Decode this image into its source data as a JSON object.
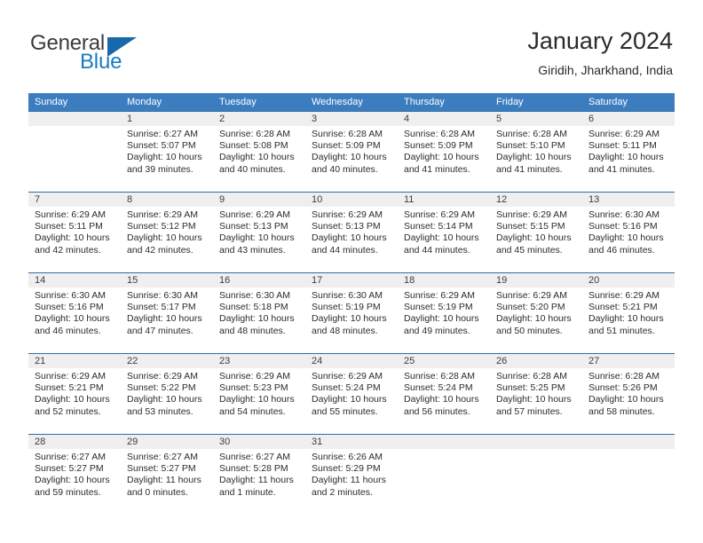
{
  "brand": {
    "name_top": "General",
    "name_bottom": "Blue",
    "accent_color": "#1b7cc2",
    "triangle_color": "#1769ab"
  },
  "header": {
    "title": "January 2024",
    "location": "Giridih, Jharkhand, India"
  },
  "theme": {
    "header_band": "#3b7dbf",
    "row_band": "#efefef",
    "row_divider": "#2e6da4"
  },
  "weekdays": [
    "Sunday",
    "Monday",
    "Tuesday",
    "Wednesday",
    "Thursday",
    "Friday",
    "Saturday"
  ],
  "weeks": [
    [
      {
        "day": "",
        "sunrise": "",
        "sunset": "",
        "daylight_a": "",
        "daylight_b": ""
      },
      {
        "day": "1",
        "sunrise": "Sunrise: 6:27 AM",
        "sunset": "Sunset: 5:07 PM",
        "daylight_a": "Daylight: 10 hours",
        "daylight_b": "and 39 minutes."
      },
      {
        "day": "2",
        "sunrise": "Sunrise: 6:28 AM",
        "sunset": "Sunset: 5:08 PM",
        "daylight_a": "Daylight: 10 hours",
        "daylight_b": "and 40 minutes."
      },
      {
        "day": "3",
        "sunrise": "Sunrise: 6:28 AM",
        "sunset": "Sunset: 5:09 PM",
        "daylight_a": "Daylight: 10 hours",
        "daylight_b": "and 40 minutes."
      },
      {
        "day": "4",
        "sunrise": "Sunrise: 6:28 AM",
        "sunset": "Sunset: 5:09 PM",
        "daylight_a": "Daylight: 10 hours",
        "daylight_b": "and 41 minutes."
      },
      {
        "day": "5",
        "sunrise": "Sunrise: 6:28 AM",
        "sunset": "Sunset: 5:10 PM",
        "daylight_a": "Daylight: 10 hours",
        "daylight_b": "and 41 minutes."
      },
      {
        "day": "6",
        "sunrise": "Sunrise: 6:29 AM",
        "sunset": "Sunset: 5:11 PM",
        "daylight_a": "Daylight: 10 hours",
        "daylight_b": "and 41 minutes."
      }
    ],
    [
      {
        "day": "7",
        "sunrise": "Sunrise: 6:29 AM",
        "sunset": "Sunset: 5:11 PM",
        "daylight_a": "Daylight: 10 hours",
        "daylight_b": "and 42 minutes."
      },
      {
        "day": "8",
        "sunrise": "Sunrise: 6:29 AM",
        "sunset": "Sunset: 5:12 PM",
        "daylight_a": "Daylight: 10 hours",
        "daylight_b": "and 42 minutes."
      },
      {
        "day": "9",
        "sunrise": "Sunrise: 6:29 AM",
        "sunset": "Sunset: 5:13 PM",
        "daylight_a": "Daylight: 10 hours",
        "daylight_b": "and 43 minutes."
      },
      {
        "day": "10",
        "sunrise": "Sunrise: 6:29 AM",
        "sunset": "Sunset: 5:13 PM",
        "daylight_a": "Daylight: 10 hours",
        "daylight_b": "and 44 minutes."
      },
      {
        "day": "11",
        "sunrise": "Sunrise: 6:29 AM",
        "sunset": "Sunset: 5:14 PM",
        "daylight_a": "Daylight: 10 hours",
        "daylight_b": "and 44 minutes."
      },
      {
        "day": "12",
        "sunrise": "Sunrise: 6:29 AM",
        "sunset": "Sunset: 5:15 PM",
        "daylight_a": "Daylight: 10 hours",
        "daylight_b": "and 45 minutes."
      },
      {
        "day": "13",
        "sunrise": "Sunrise: 6:30 AM",
        "sunset": "Sunset: 5:16 PM",
        "daylight_a": "Daylight: 10 hours",
        "daylight_b": "and 46 minutes."
      }
    ],
    [
      {
        "day": "14",
        "sunrise": "Sunrise: 6:30 AM",
        "sunset": "Sunset: 5:16 PM",
        "daylight_a": "Daylight: 10 hours",
        "daylight_b": "and 46 minutes."
      },
      {
        "day": "15",
        "sunrise": "Sunrise: 6:30 AM",
        "sunset": "Sunset: 5:17 PM",
        "daylight_a": "Daylight: 10 hours",
        "daylight_b": "and 47 minutes."
      },
      {
        "day": "16",
        "sunrise": "Sunrise: 6:30 AM",
        "sunset": "Sunset: 5:18 PM",
        "daylight_a": "Daylight: 10 hours",
        "daylight_b": "and 48 minutes."
      },
      {
        "day": "17",
        "sunrise": "Sunrise: 6:30 AM",
        "sunset": "Sunset: 5:19 PM",
        "daylight_a": "Daylight: 10 hours",
        "daylight_b": "and 48 minutes."
      },
      {
        "day": "18",
        "sunrise": "Sunrise: 6:29 AM",
        "sunset": "Sunset: 5:19 PM",
        "daylight_a": "Daylight: 10 hours",
        "daylight_b": "and 49 minutes."
      },
      {
        "day": "19",
        "sunrise": "Sunrise: 6:29 AM",
        "sunset": "Sunset: 5:20 PM",
        "daylight_a": "Daylight: 10 hours",
        "daylight_b": "and 50 minutes."
      },
      {
        "day": "20",
        "sunrise": "Sunrise: 6:29 AM",
        "sunset": "Sunset: 5:21 PM",
        "daylight_a": "Daylight: 10 hours",
        "daylight_b": "and 51 minutes."
      }
    ],
    [
      {
        "day": "21",
        "sunrise": "Sunrise: 6:29 AM",
        "sunset": "Sunset: 5:21 PM",
        "daylight_a": "Daylight: 10 hours",
        "daylight_b": "and 52 minutes."
      },
      {
        "day": "22",
        "sunrise": "Sunrise: 6:29 AM",
        "sunset": "Sunset: 5:22 PM",
        "daylight_a": "Daylight: 10 hours",
        "daylight_b": "and 53 minutes."
      },
      {
        "day": "23",
        "sunrise": "Sunrise: 6:29 AM",
        "sunset": "Sunset: 5:23 PM",
        "daylight_a": "Daylight: 10 hours",
        "daylight_b": "and 54 minutes."
      },
      {
        "day": "24",
        "sunrise": "Sunrise: 6:29 AM",
        "sunset": "Sunset: 5:24 PM",
        "daylight_a": "Daylight: 10 hours",
        "daylight_b": "and 55 minutes."
      },
      {
        "day": "25",
        "sunrise": "Sunrise: 6:28 AM",
        "sunset": "Sunset: 5:24 PM",
        "daylight_a": "Daylight: 10 hours",
        "daylight_b": "and 56 minutes."
      },
      {
        "day": "26",
        "sunrise": "Sunrise: 6:28 AM",
        "sunset": "Sunset: 5:25 PM",
        "daylight_a": "Daylight: 10 hours",
        "daylight_b": "and 57 minutes."
      },
      {
        "day": "27",
        "sunrise": "Sunrise: 6:28 AM",
        "sunset": "Sunset: 5:26 PM",
        "daylight_a": "Daylight: 10 hours",
        "daylight_b": "and 58 minutes."
      }
    ],
    [
      {
        "day": "28",
        "sunrise": "Sunrise: 6:27 AM",
        "sunset": "Sunset: 5:27 PM",
        "daylight_a": "Daylight: 10 hours",
        "daylight_b": "and 59 minutes."
      },
      {
        "day": "29",
        "sunrise": "Sunrise: 6:27 AM",
        "sunset": "Sunset: 5:27 PM",
        "daylight_a": "Daylight: 11 hours",
        "daylight_b": "and 0 minutes."
      },
      {
        "day": "30",
        "sunrise": "Sunrise: 6:27 AM",
        "sunset": "Sunset: 5:28 PM",
        "daylight_a": "Daylight: 11 hours",
        "daylight_b": "and 1 minute."
      },
      {
        "day": "31",
        "sunrise": "Sunrise: 6:26 AM",
        "sunset": "Sunset: 5:29 PM",
        "daylight_a": "Daylight: 11 hours",
        "daylight_b": "and 2 minutes."
      },
      {
        "day": "",
        "sunrise": "",
        "sunset": "",
        "daylight_a": "",
        "daylight_b": ""
      },
      {
        "day": "",
        "sunrise": "",
        "sunset": "",
        "daylight_a": "",
        "daylight_b": ""
      },
      {
        "day": "",
        "sunrise": "",
        "sunset": "",
        "daylight_a": "",
        "daylight_b": ""
      }
    ]
  ]
}
